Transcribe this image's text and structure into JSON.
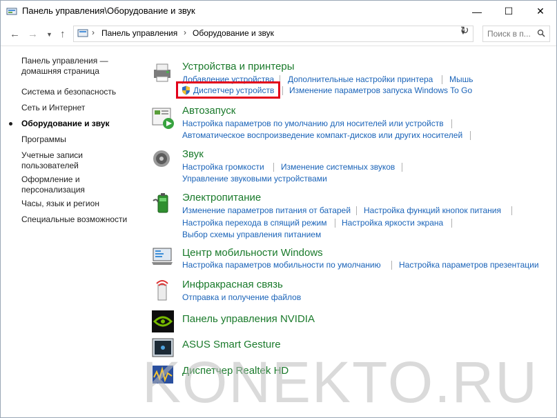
{
  "window": {
    "title": "Панель управления\\Оборудование и звук",
    "controls": {
      "minimize": "—",
      "maximize": "☐",
      "close": "✕"
    }
  },
  "address": {
    "breadcrumbs": [
      "Панель управления",
      "Оборудование и звук"
    ],
    "separator": "›",
    "search_placeholder": "Поиск в п..."
  },
  "sidebar": {
    "items": [
      {
        "label": "Панель управления — домашняя страница",
        "active": false
      },
      {
        "label": "Система и безопасность",
        "active": false
      },
      {
        "label": "Сеть и Интернет",
        "active": false
      },
      {
        "label": "Оборудование и звук",
        "active": true
      },
      {
        "label": "Программы",
        "active": false
      },
      {
        "label": "Учетные записи пользователей",
        "active": false
      },
      {
        "label": "Оформление и персонализация",
        "active": false
      },
      {
        "label": "Часы, язык и регион",
        "active": false
      },
      {
        "label": "Специальные возможности",
        "active": false
      }
    ]
  },
  "categories": [
    {
      "title": "Устройства и принтеры",
      "icon": "printer-icon",
      "links": [
        "Добавление устройства",
        "Дополнительные настройки принтера",
        "Мышь",
        "Диспетчер устройств",
        "Изменение параметров запуска Windows To Go"
      ]
    },
    {
      "title": "Автозапуск",
      "icon": "autoplay-icon",
      "links": [
        "Настройка параметров по умолчанию для носителей или устройств",
        "Автоматическое воспроизведение компакт-дисков или других носителей"
      ]
    },
    {
      "title": "Звук",
      "icon": "speaker-icon",
      "links": [
        "Настройка громкости",
        "Изменение системных звуков",
        "Управление звуковыми устройствами"
      ]
    },
    {
      "title": "Электропитание",
      "icon": "battery-icon",
      "links": [
        "Изменение параметров питания от батарей",
        "Настройка функций кнопок питания",
        "Настройка перехода в спящий режим",
        "Настройка яркости экрана",
        "Выбор схемы управления питанием"
      ]
    },
    {
      "title": "Центр мобильности Windows",
      "icon": "mobility-center-icon",
      "links": [
        "Настройка параметров мобильности по умолчанию",
        "Настройка параметров презентации"
      ]
    },
    {
      "title": "Инфракрасная связь",
      "icon": "infrared-icon",
      "links": [
        "Отправка и получение файлов"
      ]
    },
    {
      "title": "Панель управления NVIDIA",
      "icon": "nvidia-icon",
      "links": []
    },
    {
      "title": "ASUS Smart Gesture",
      "icon": "touchpad-icon",
      "links": []
    },
    {
      "title": "Диспетчер Realtek HD",
      "icon": "realtek-icon",
      "links": []
    }
  ],
  "highlighted_link": "Диспетчер устройств",
  "watermark": "KONEKTO.RU",
  "colors": {
    "category_title": "#1a7a2b",
    "link": "#1a63b8",
    "highlight": "#e2001a"
  }
}
